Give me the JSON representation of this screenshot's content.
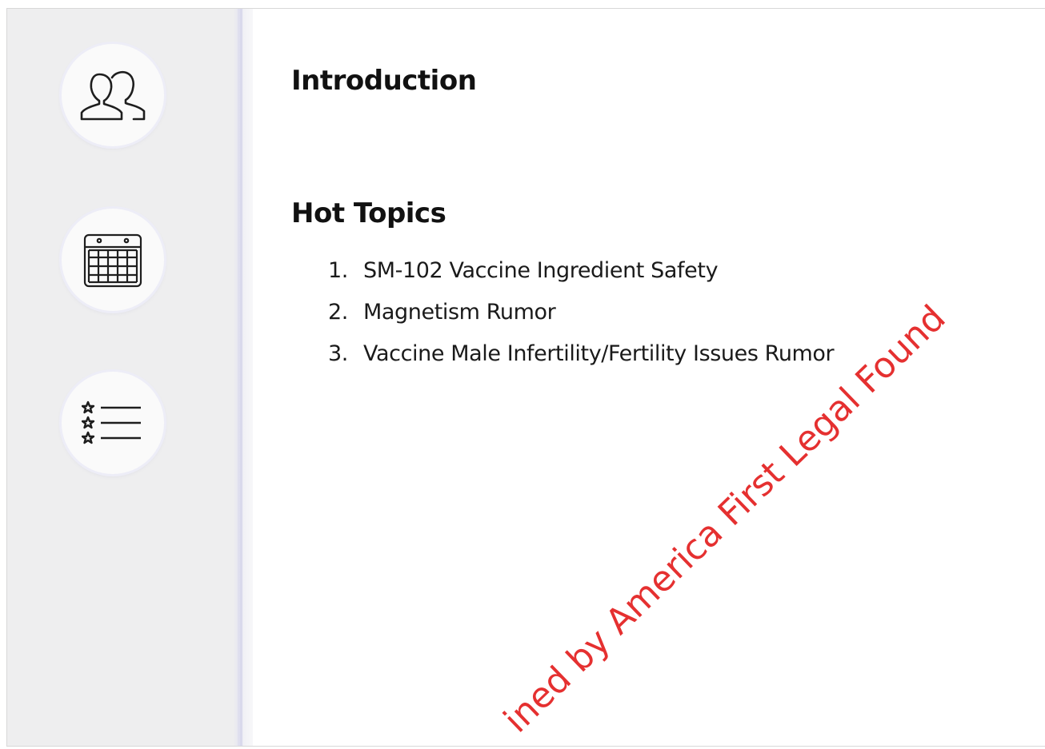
{
  "sidebar": {
    "icons": [
      {
        "name": "people-icon"
      },
      {
        "name": "calendar-icon"
      },
      {
        "name": "starred-list-icon"
      }
    ]
  },
  "main": {
    "sections": [
      {
        "title": "Introduction"
      },
      {
        "title": "Hot Topics"
      }
    ],
    "hot_topics": [
      {
        "number": "1.",
        "text": "SM-102 Vaccine Ingredient Safety"
      },
      {
        "number": "2.",
        "text": "Magnetism Rumor"
      },
      {
        "number": "3.",
        "text": "Vaccine Male Infertility/Fertility Issues Rumor"
      }
    ]
  },
  "watermark": {
    "text": "ined by America First Legal Found",
    "color": "#e53030"
  },
  "colors": {
    "sidebar_bg": "#eeeeef",
    "text": "#111111"
  }
}
